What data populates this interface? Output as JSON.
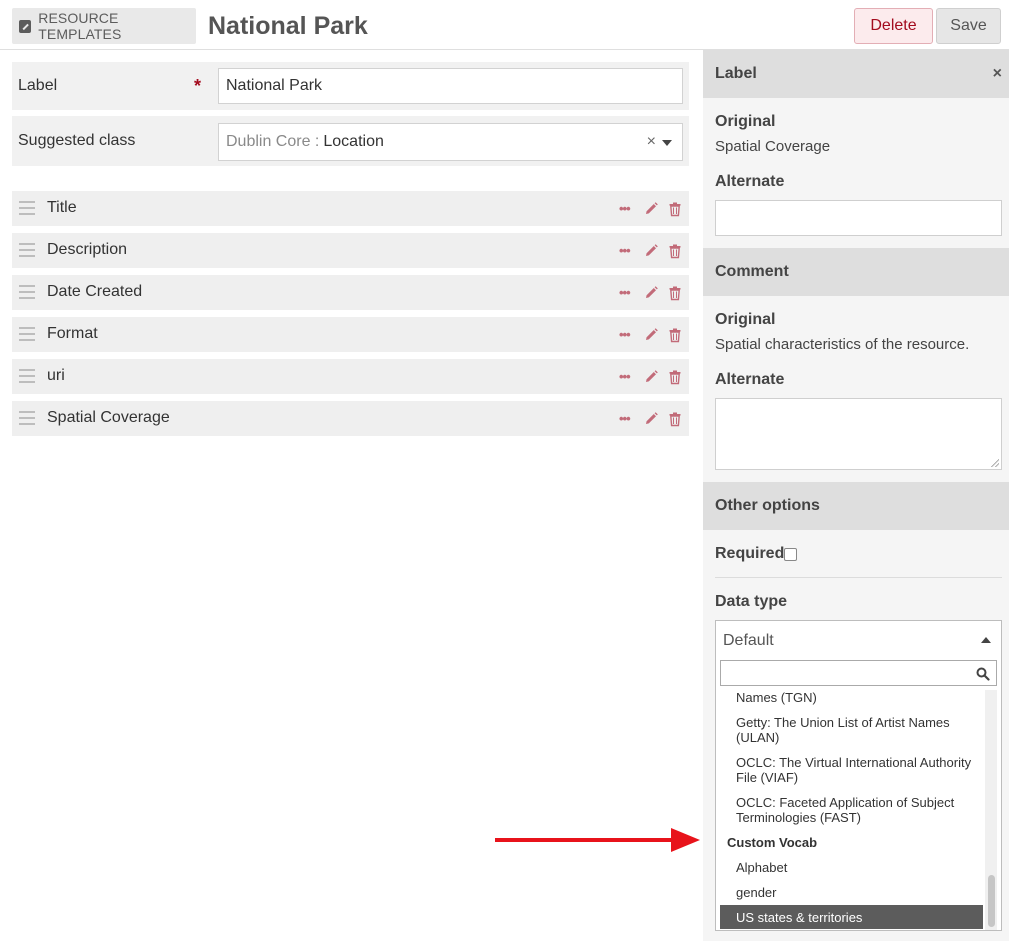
{
  "header": {
    "breadcrumb": "RESOURCE TEMPLATES",
    "title": "National Park",
    "delete_label": "Delete",
    "save_label": "Save"
  },
  "form": {
    "label_field": {
      "label": "Label",
      "required_mark": "*",
      "value": "National Park"
    },
    "class_field": {
      "label": "Suggested class",
      "prefix": "Dublin Core :",
      "value": "Location",
      "clear": "×"
    }
  },
  "properties": [
    {
      "label": "Title"
    },
    {
      "label": "Description"
    },
    {
      "label": "Date Created"
    },
    {
      "label": "Format"
    },
    {
      "label": "uri"
    },
    {
      "label": "Spatial Coverage"
    }
  ],
  "sidebar": {
    "label_section": {
      "heading": "Label",
      "close": "×",
      "original_heading": "Original",
      "original_value": "Spatial Coverage",
      "alternate_heading": "Alternate",
      "alternate_value": ""
    },
    "comment_section": {
      "heading": "Comment",
      "original_heading": "Original",
      "original_value": "Spatial characteristics of the resource.",
      "alternate_heading": "Alternate",
      "alternate_value": ""
    },
    "other_options": {
      "heading": "Other options",
      "required_label": "Required",
      "required_checked": false,
      "data_type_label": "Data type",
      "data_type_value": "Default"
    },
    "dropdown": {
      "search_value": "",
      "options": [
        "Names (TGN)",
        "Getty: The Union List of Artist Names (ULAN)",
        "OCLC: The Virtual International Authority File (VIAF)",
        "OCLC: Faceted Application of Subject Terminologies (FAST)"
      ],
      "group_label": "Custom Vocab",
      "group_options": [
        "Alphabet",
        "gender",
        "US states & territories"
      ],
      "highlighted": "US states & territories"
    }
  },
  "colors": {
    "accent_red": "#a30b1e",
    "icon_red": "#c26b79",
    "highlight": "#5c5c5c",
    "arrow": "#e8131b"
  }
}
